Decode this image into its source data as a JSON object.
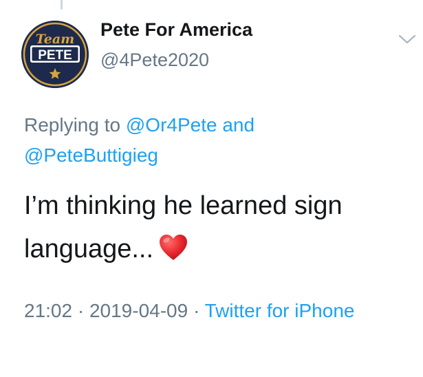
{
  "author": {
    "display_name": "Pete For America",
    "handle": "@4Pete2020",
    "avatar": {
      "team_text": "Team",
      "pete_text": "PETE",
      "icon": "star-icon",
      "colors": {
        "background": "#1d2a4d",
        "gold": "#d9a43b",
        "white": "#ffffff"
      }
    }
  },
  "reply": {
    "prefix": "Replying to ",
    "mention_1": "@Or4Pete",
    "connector": " and",
    "mention_2": "@PeteButtigieg"
  },
  "tweet": {
    "text": "I’m thinking he learned sign language...",
    "emoji": "red-heart-icon"
  },
  "meta": {
    "time": "21:02",
    "separator_1": " · ",
    "date": "2019-04-09",
    "separator_2": " · ",
    "source": "Twitter for iPhone"
  },
  "colors": {
    "text": "#14171a",
    "secondary": "#657786",
    "link": "#1da1f2",
    "heart": "#e0245e"
  }
}
